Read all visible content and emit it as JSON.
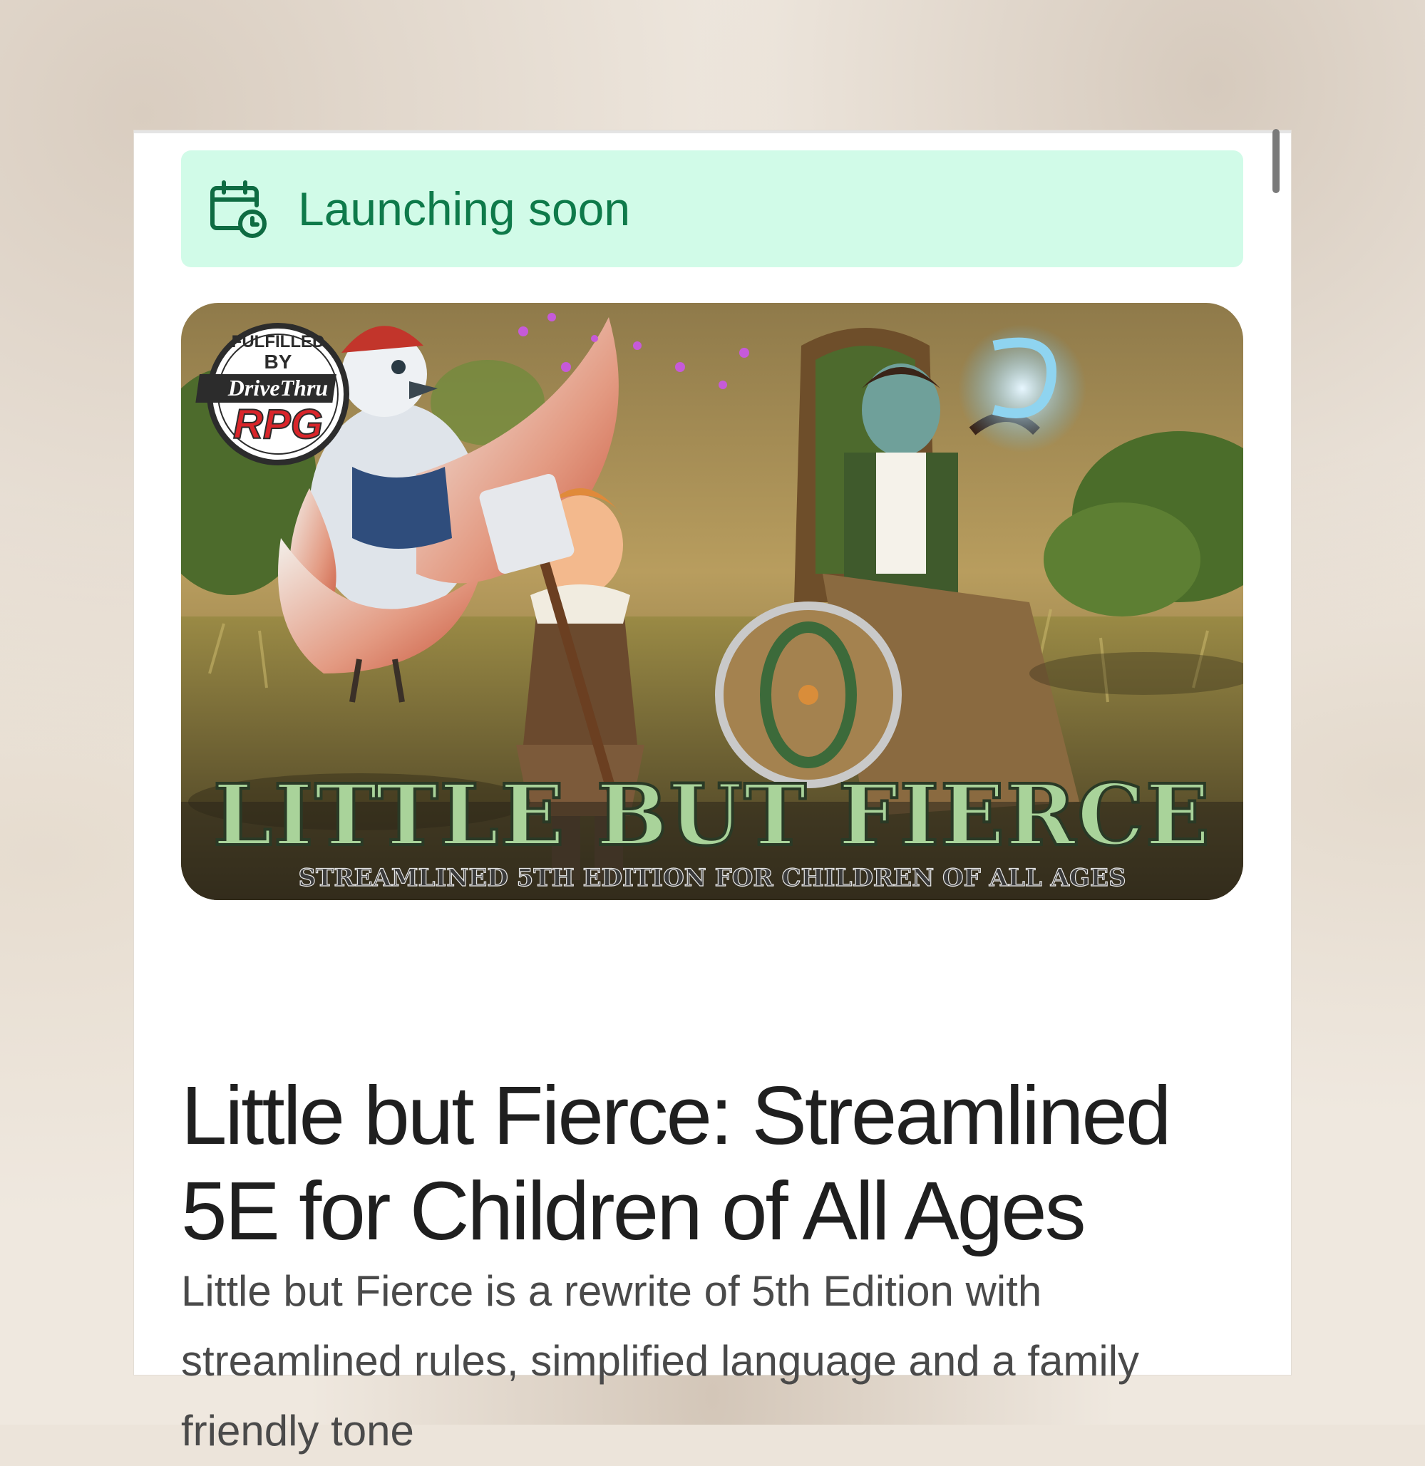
{
  "banner": {
    "status_label": "Launching soon",
    "icon": "calendar-clock-icon"
  },
  "hero": {
    "badge_top": "FULFILLED",
    "badge_by": "BY",
    "badge_brand": "DriveThru",
    "badge_rpg": "RPG",
    "logo_title": "LITTLE BUT FIERCE",
    "logo_subtitle": "STREAMLINED 5TH EDITION FOR CHILDREN OF ALL AGES"
  },
  "product": {
    "title": "Little but Fierce: Streamlined 5E for Children of All Ages",
    "description": "Little but Fierce is a rewrite of 5th Edition with streamlined rules, simplified language and a family friendly tone"
  },
  "colors": {
    "banner_bg": "#d1fbe8",
    "banner_text": "#0e7a4a",
    "title_text": "#1f1f1f",
    "body_text": "#4a4a4a"
  }
}
